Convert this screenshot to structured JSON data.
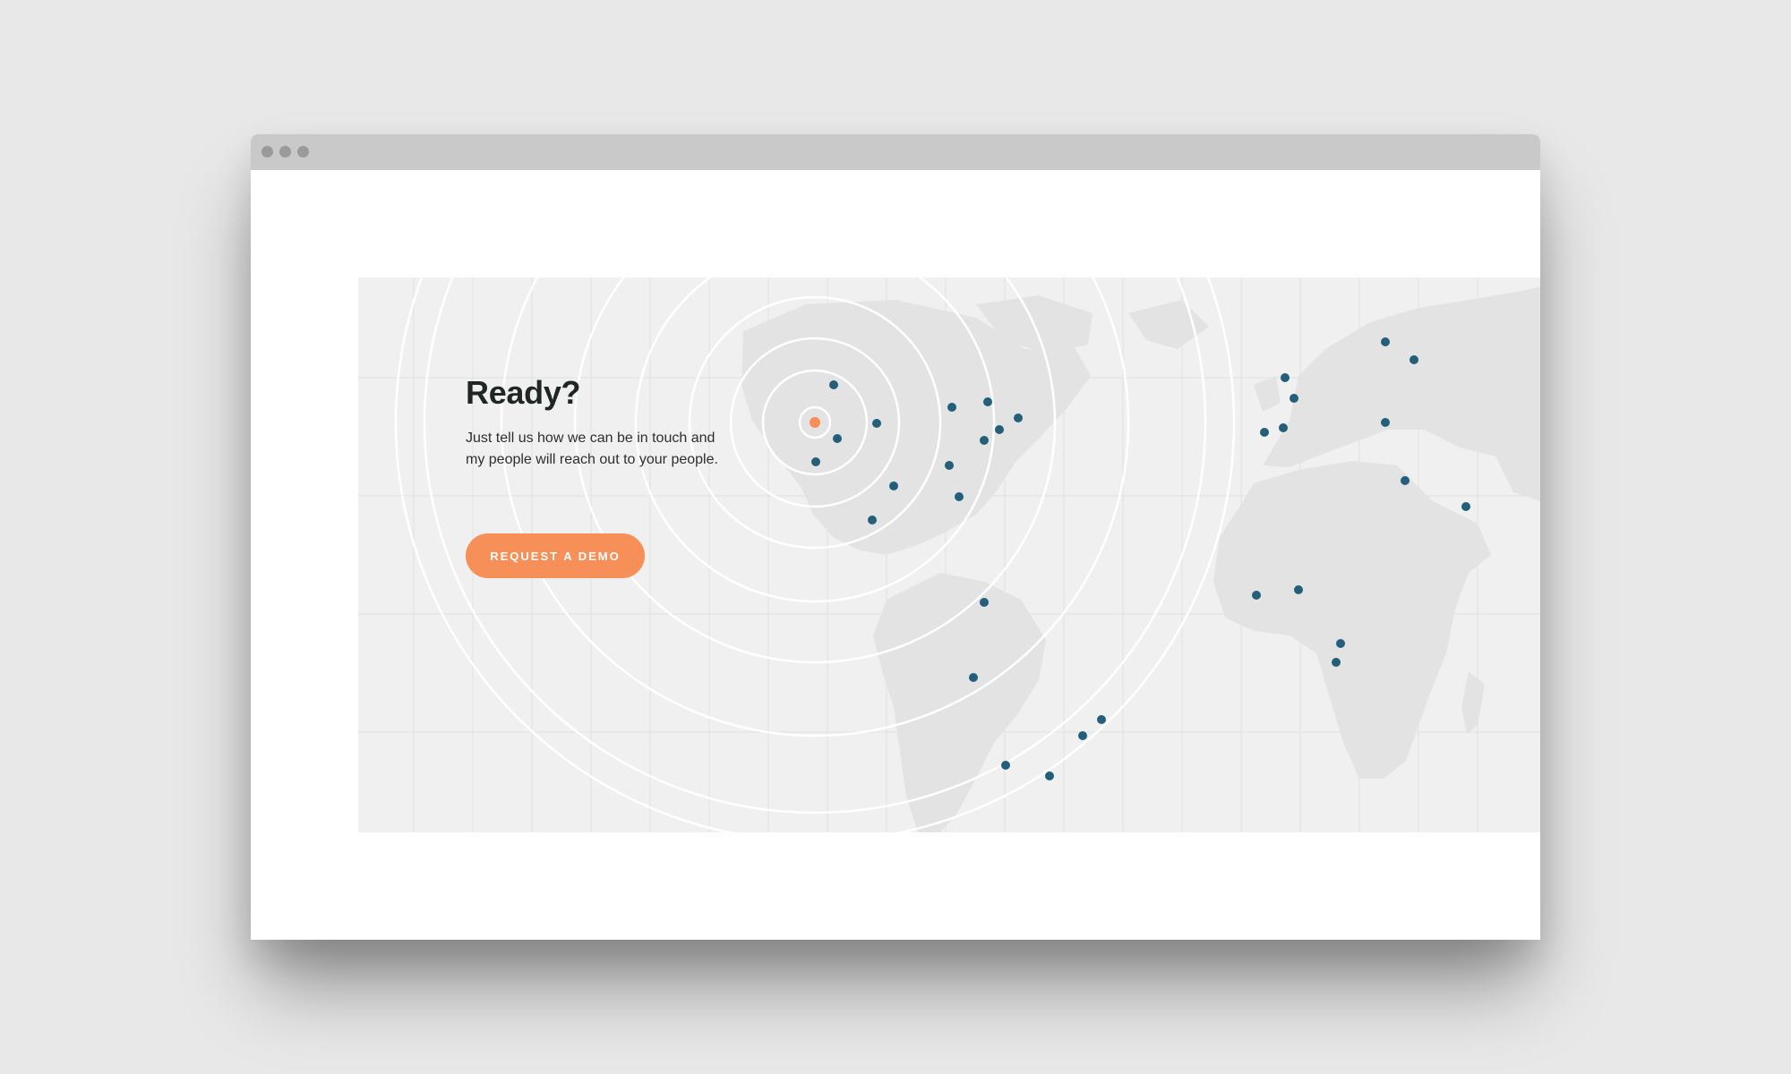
{
  "hero": {
    "headline": "Ready?",
    "body": "Just tell us how we can be in touch and my people will reach out to your people.",
    "cta_label": "REQUEST A DEMO"
  },
  "colors": {
    "page_background": "#e8e8e8",
    "titlebar": "#c9c9c9",
    "map_background": "#f0f0f0",
    "land": "#e3e3e3",
    "location_dot": "#235f7b",
    "origin_dot": "#f68f58",
    "cta": "#f68f58",
    "ring": "#ffffff"
  },
  "icons": [
    "window-control-dot",
    "location-pin-dot",
    "origin-pin-dot",
    "radar-rings"
  ]
}
